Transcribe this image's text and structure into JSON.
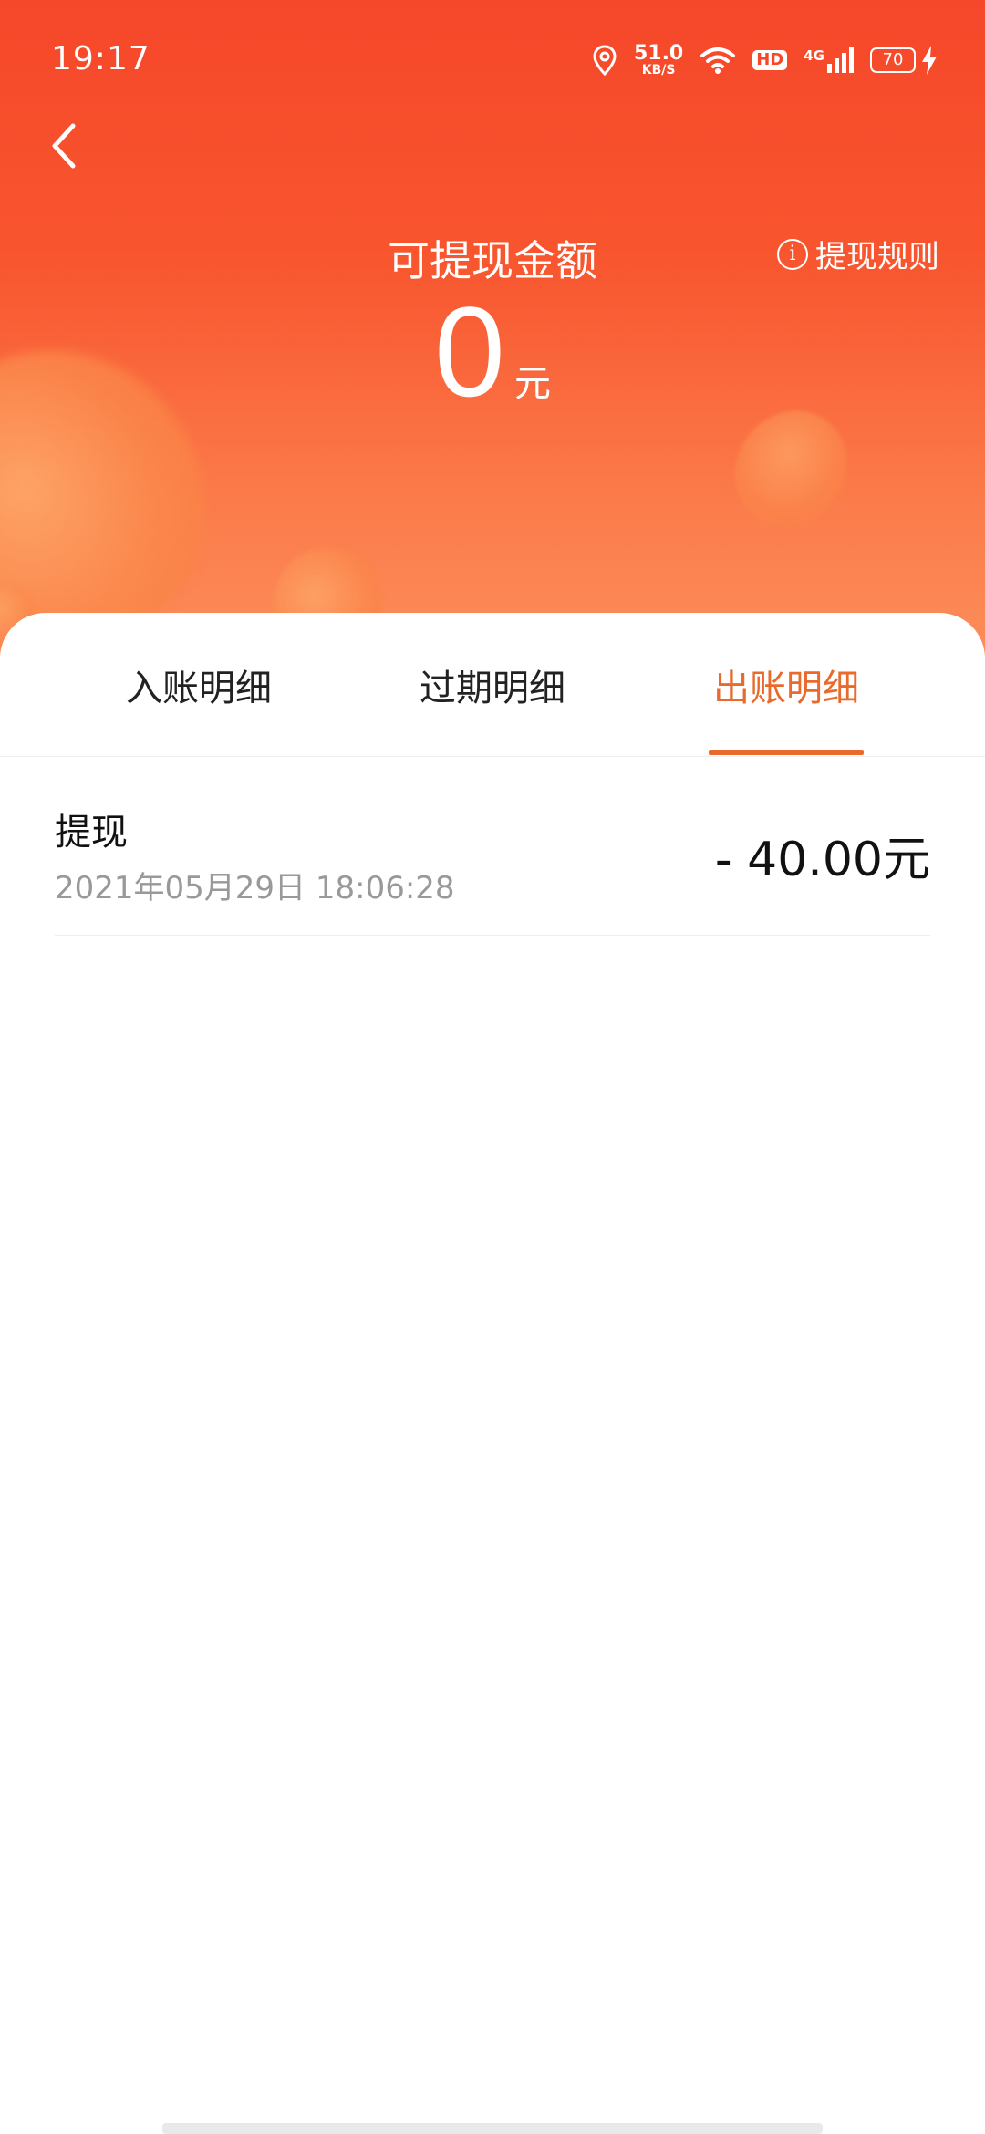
{
  "status_bar": {
    "time": "19:17",
    "net_speed": "51.0",
    "net_speed_unit": "KB/S",
    "hd": "HD",
    "network": "4G",
    "battery": "70"
  },
  "header": {
    "title": "可提现金额",
    "rules_label": "提现规则",
    "info_glyph": "i",
    "balance": "0",
    "balance_unit": "元"
  },
  "tabs": [
    {
      "label": "入账明细",
      "active": false
    },
    {
      "label": "过期明细",
      "active": false
    },
    {
      "label": "出账明细",
      "active": true
    }
  ],
  "records": [
    {
      "type": "提现",
      "time": "2021年05月29日 18:06:28",
      "amount": "- 40.00元"
    }
  ],
  "colors": {
    "header_start": "#f6472a",
    "header_end": "#fc8d5a",
    "accent": "#e86a2c",
    "text_primary": "#111111",
    "text_secondary": "#999999"
  },
  "icons": {
    "back": "back-arrow-icon",
    "location": "location-icon",
    "wifi": "wifi-icon",
    "signal": "signal-icon",
    "charging": "lightning-icon",
    "info": "info-icon"
  }
}
